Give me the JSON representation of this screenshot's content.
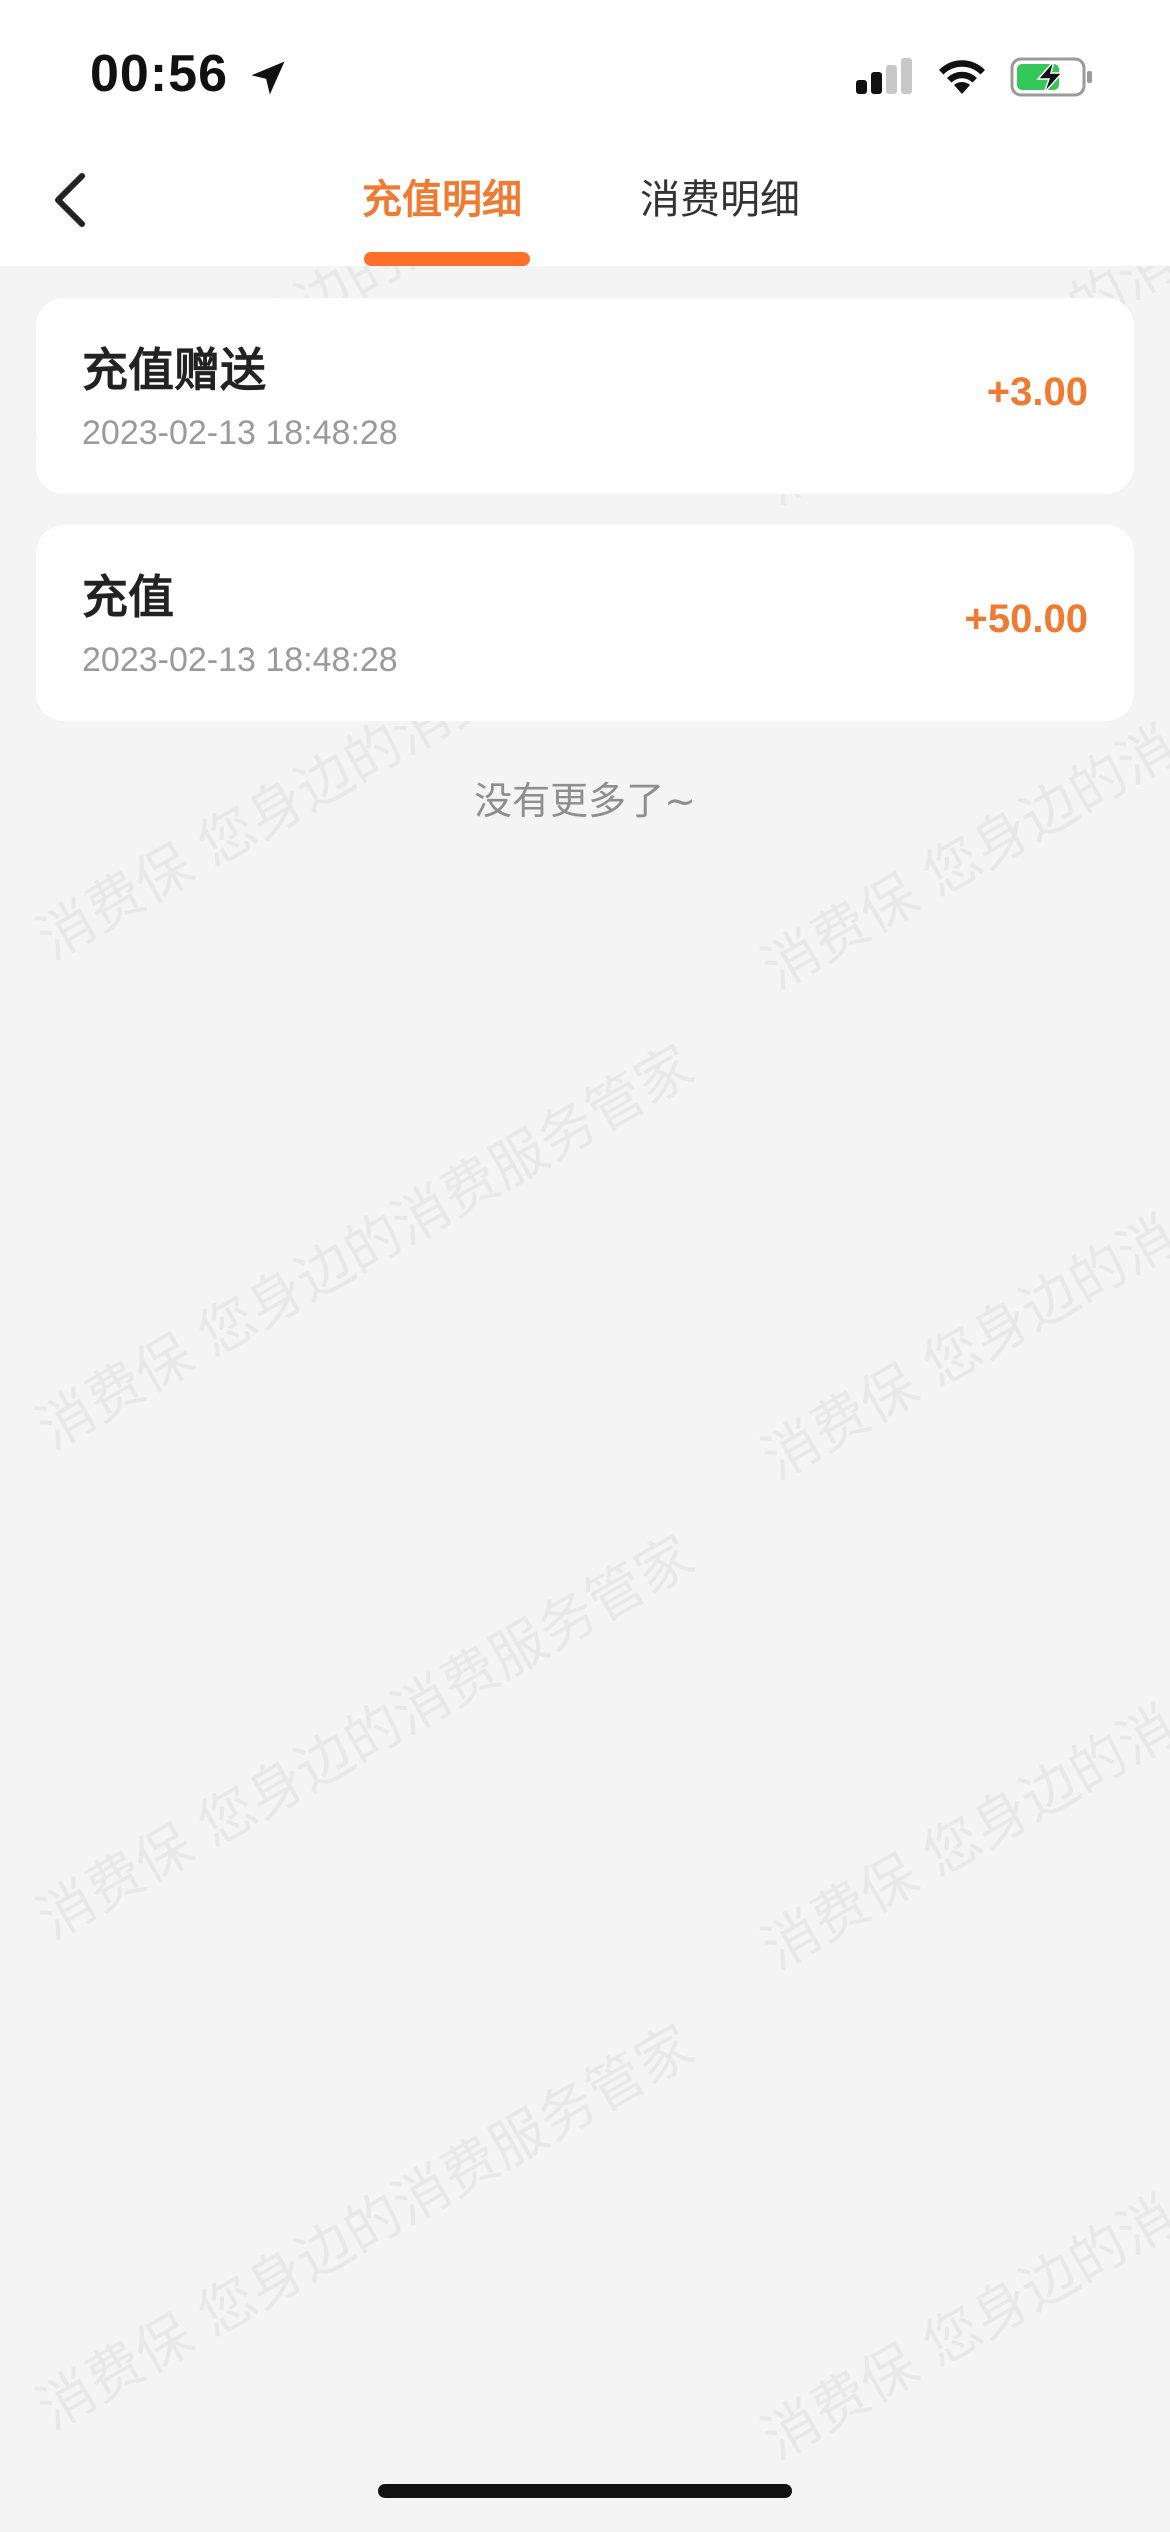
{
  "status_bar": {
    "time": "00:56"
  },
  "nav": {
    "tabs": [
      {
        "label": "充值明细",
        "active": true
      },
      {
        "label": "消费明细",
        "active": false
      }
    ]
  },
  "records": [
    {
      "title": "充值赠送",
      "time": "2023-02-13 18:48:28",
      "amount": "+3.00"
    },
    {
      "title": "充值",
      "time": "2023-02-13 18:48:28",
      "amount": "+50.00"
    }
  ],
  "no_more_text": "没有更多了~",
  "watermark": {
    "line_a": "消费保 您身边的消费服务管家",
    "line_b": "消费保 您身边的消"
  },
  "colors": {
    "accent": "#ef7a32",
    "indicator": "#ff6f2a",
    "background": "#f4f4f4"
  }
}
